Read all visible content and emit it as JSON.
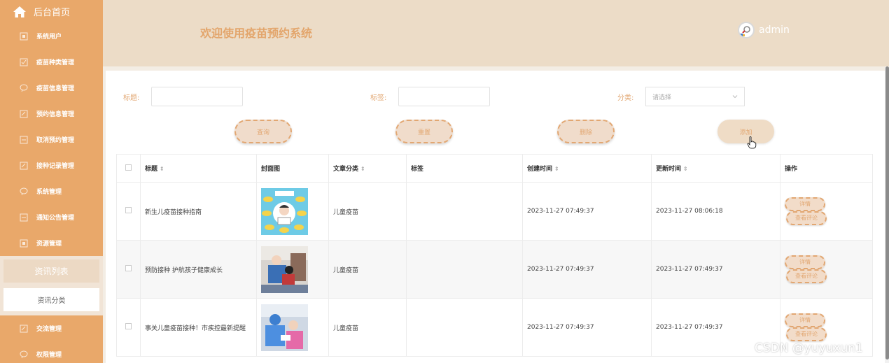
{
  "sidebar": {
    "home": "后台首页",
    "items": [
      "系统用户",
      "疫苗种类管理",
      "疫苗信息管理",
      "预约信息管理",
      "取消预约管理",
      "接种记录管理",
      "系统管理",
      "通知公告管理",
      "资源管理"
    ],
    "sub_items": [
      "资讯列表",
      "资讯分类"
    ],
    "items_after": [
      "交流管理",
      "权限管理"
    ]
  },
  "header": {
    "title": "欢迎使用疫苗预约系统",
    "username": "admin"
  },
  "filters": {
    "title_label": "标题:",
    "tag_label": "标签:",
    "category_label": "分类:",
    "category_placeholder": "请选择"
  },
  "buttons": {
    "search": "查询",
    "reset": "重置",
    "delete": "删除",
    "add": "添加"
  },
  "table": {
    "headers": [
      "标题",
      "封面图",
      "文章分类",
      "标签",
      "创建时间",
      "更新时间",
      "操作"
    ],
    "rows": [
      {
        "title": "新生儿疫苗接种指南",
        "category": "儿童疫苗",
        "tag": "",
        "created": "2023-11-27 07:49:37",
        "updated": "2023-11-27 08:06:18"
      },
      {
        "title": "预防接种 护航孩子健康成长",
        "category": "儿童疫苗",
        "tag": "",
        "created": "2023-11-27 07:49:37",
        "updated": "2023-11-27 07:49:37"
      },
      {
        "title": "事关儿童疫苗接种！市疾控最新提醒",
        "category": "儿童疫苗",
        "tag": "",
        "created": "2023-11-27 07:49:37",
        "updated": "2023-11-27 07:49:37"
      }
    ],
    "row_actions": {
      "detail": "详情",
      "comments": "查看评论"
    }
  },
  "watermark": "CSDN @yuyuxun1",
  "colors": {
    "sidebar": "#e9a86a",
    "header": "#ecdcc7",
    "accent": "#e2a772"
  }
}
